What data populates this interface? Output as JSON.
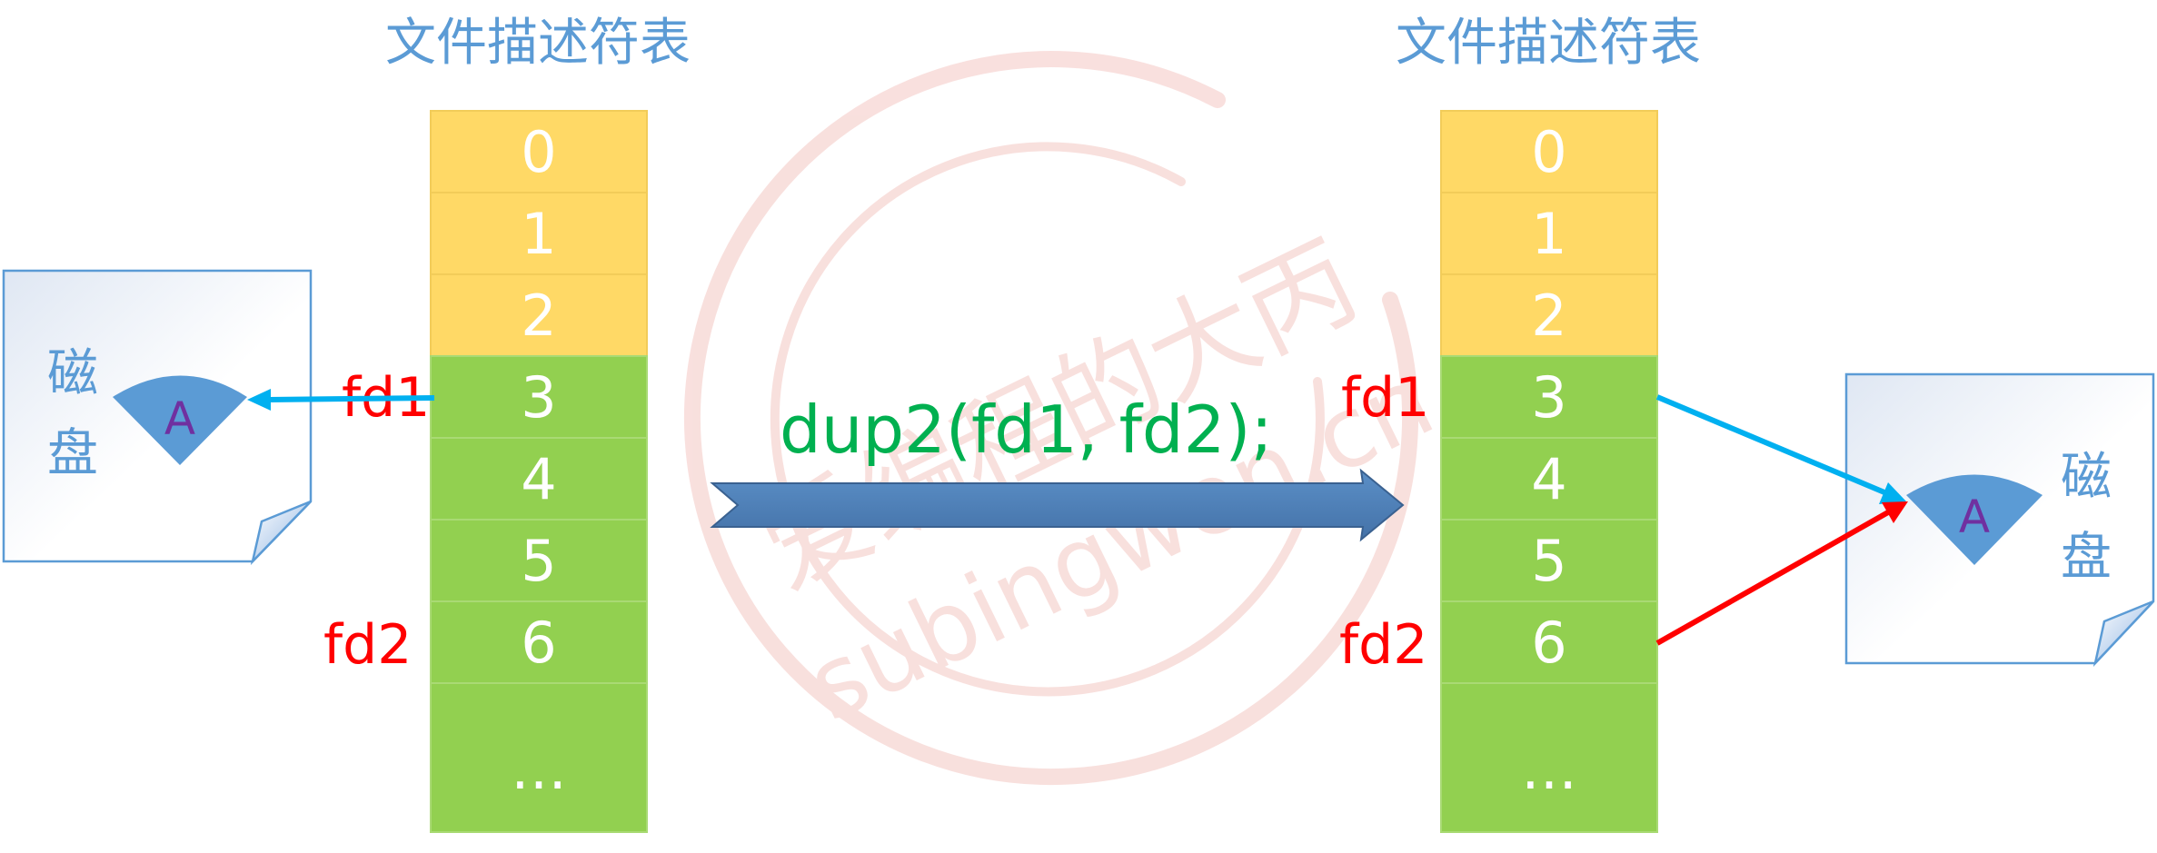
{
  "watermark": {
    "text_cn": "爱编程的大丙",
    "text_url": "subingwen.cn",
    "color": "#f4c7c3"
  },
  "left_table": {
    "title": "文件描述符表",
    "rows": [
      "0",
      "1",
      "2",
      "3",
      "4",
      "5",
      "6",
      "…"
    ],
    "fd1_label": "fd1",
    "fd2_label": "fd2"
  },
  "right_table": {
    "title": "文件描述符表",
    "rows": [
      "0",
      "1",
      "2",
      "3",
      "4",
      "5",
      "6",
      "…"
    ],
    "fd1_label": "fd1",
    "fd2_label": "fd2"
  },
  "left_disk": {
    "label_line1": "磁",
    "label_line2": "盘",
    "file_label": "A"
  },
  "right_disk": {
    "label_line1": "磁",
    "label_line2": "盘",
    "file_label": "A"
  },
  "operation": {
    "code": "dup2(fd1, fd2);"
  },
  "colors": {
    "title_blue": "#5b9bd5",
    "reserved_yellow": "#ffd966",
    "free_green": "#92d050",
    "fd_label_red": "#ff0000",
    "code_green": "#00b050",
    "pointer_blue": "#00b0f0",
    "pointer_red": "#ff0000",
    "sector_blue": "#5b9bd5",
    "file_letter_purple": "#7030a0",
    "big_arrow_blue": "#4f81bd"
  }
}
